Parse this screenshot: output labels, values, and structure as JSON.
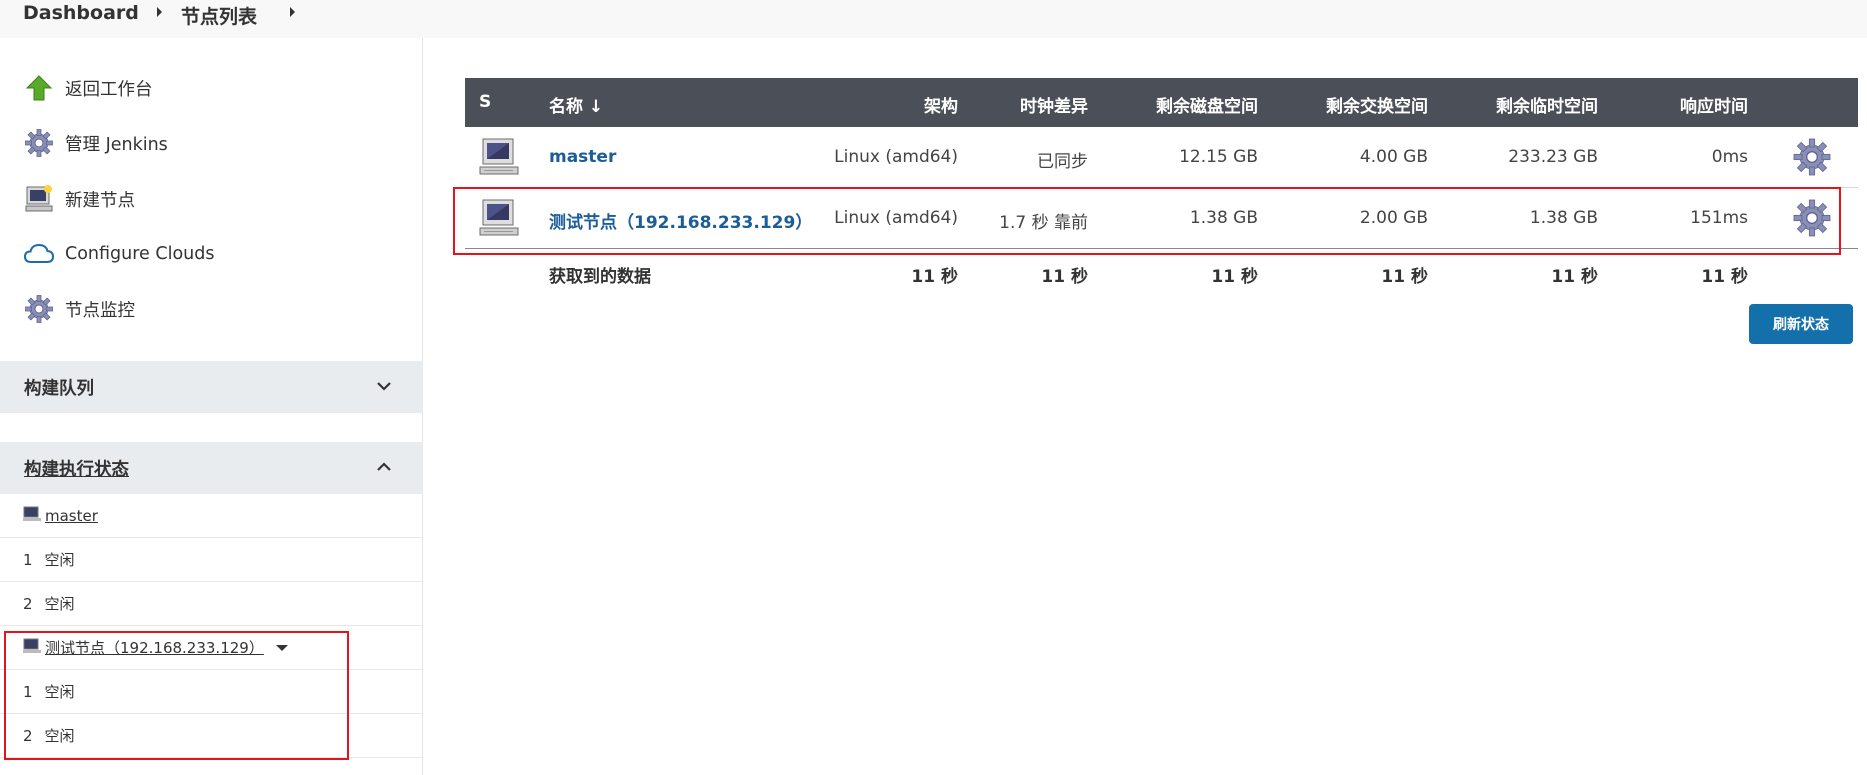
{
  "breadcrumb": {
    "items": [
      "Dashboard",
      "节点列表"
    ]
  },
  "tasks": [
    {
      "label": "返回工作台",
      "icon": "up-arrow-icon"
    },
    {
      "label": "管理 Jenkins",
      "icon": "gear-icon"
    },
    {
      "label": "新建节点",
      "icon": "computer-icon"
    },
    {
      "label": "Configure Clouds",
      "icon": "cloud-icon"
    },
    {
      "label": "节点监控",
      "icon": "gear-icon"
    }
  ],
  "build_queue": {
    "title": "构建队列"
  },
  "executors": {
    "title": "构建执行状态",
    "nodes": [
      {
        "name": "master",
        "slots": [
          {
            "num": "1",
            "status": "空闲"
          },
          {
            "num": "2",
            "status": "空闲"
          }
        ]
      },
      {
        "name": "测试节点（192.168.233.129）",
        "slots": [
          {
            "num": "1",
            "status": "空闲"
          },
          {
            "num": "2",
            "status": "空闲"
          }
        ]
      }
    ]
  },
  "table": {
    "headers": {
      "s": "S",
      "name": "名称 ↓",
      "arch": "架构",
      "clock": "时钟差异",
      "disk": "剩余磁盘空间",
      "swap": "剩余交换空间",
      "temp": "剩余临时空间",
      "response": "响应时间"
    },
    "rows": [
      {
        "name": "master",
        "arch": "Linux (amd64)",
        "clock": "已同步",
        "disk": "12.15 GB",
        "swap": "4.00 GB",
        "temp": "233.23 GB",
        "response": "0ms"
      },
      {
        "name": "测试节点（192.168.233.129）",
        "arch": "Linux (amd64)",
        "clock": "1.7 秒 靠前",
        "disk": "1.38 GB",
        "swap": "2.00 GB",
        "temp": "1.38 GB",
        "response": "151ms"
      }
    ],
    "summary": {
      "label": "获取到的数据",
      "arch": "11 秒",
      "clock": "11 秒",
      "disk": "11 秒",
      "swap": "11 秒",
      "temp": "11 秒",
      "response": "11 秒"
    }
  },
  "refresh_button": {
    "label": "刷新状态"
  },
  "colors": {
    "header_bg": "#4b5058",
    "link": "#1b5d99",
    "button": "#1470aa",
    "highlight": "#e8121c"
  }
}
